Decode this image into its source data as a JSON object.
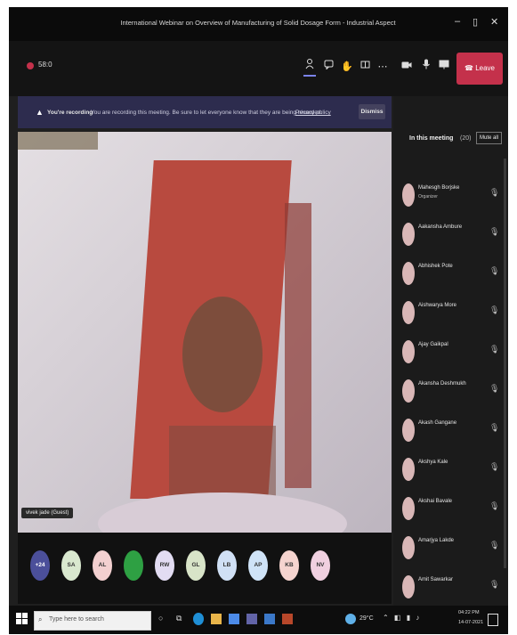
{
  "window": {
    "title": "International Webinar on Overview of Manufacturing of Solid Dosage Form - Industrial Aspect",
    "minimize": "–",
    "maximize": "▯",
    "close": "✕"
  },
  "toolbar": {
    "timer": "58:0",
    "leave_label": "Leave"
  },
  "banner": {
    "title": "You're recording",
    "message": "You are recording this meeting. Be sure to let everyone know that they are being recorded.",
    "link": "Privacy policy",
    "dismiss": "Dismiss"
  },
  "video": {
    "participant_label": "vivek jade (Guest)"
  },
  "strip": {
    "avatars": [
      {
        "initials": "+24",
        "color": "#4b4f9a"
      },
      {
        "initials": "SA",
        "color": "#d9e8cf"
      },
      {
        "initials": "AL",
        "color": "#f3d0d0"
      },
      {
        "initials": "",
        "color": "#2ea043"
      },
      {
        "initials": "RW",
        "color": "#e2dcf2"
      },
      {
        "initials": "GL",
        "color": "#d8e4c8"
      },
      {
        "initials": "LB",
        "color": "#d0e0f5"
      },
      {
        "initials": "AP",
        "color": "#cfe3f7"
      },
      {
        "initials": "KB",
        "color": "#f5d4cf"
      },
      {
        "initials": "NV",
        "color": "#f0d0e0"
      }
    ]
  },
  "panel": {
    "title": "In this meeting",
    "count": "(20)",
    "mute_all": "Mute all",
    "participants": [
      {
        "name": "Mahesgh Borjske",
        "role": "Organizer"
      },
      {
        "name": "Aakansha Ambure",
        "role": ""
      },
      {
        "name": "Abhishek Pote",
        "role": ""
      },
      {
        "name": "Aishwarya More",
        "role": ""
      },
      {
        "name": "Ajay Gaikpal",
        "role": ""
      },
      {
        "name": "Akansha Deshmukh",
        "role": ""
      },
      {
        "name": "Akash Gangane",
        "role": ""
      },
      {
        "name": "Akshya Kale",
        "role": ""
      },
      {
        "name": "Akshai Bavale",
        "role": ""
      },
      {
        "name": "Amarjya Lakde",
        "role": ""
      },
      {
        "name": "Amit Sawarkar",
        "role": ""
      }
    ]
  },
  "taskbar": {
    "search_placeholder": "Type here to search",
    "temperature": "29°C",
    "time": "04:22 PM",
    "date": "14-07-2021"
  }
}
